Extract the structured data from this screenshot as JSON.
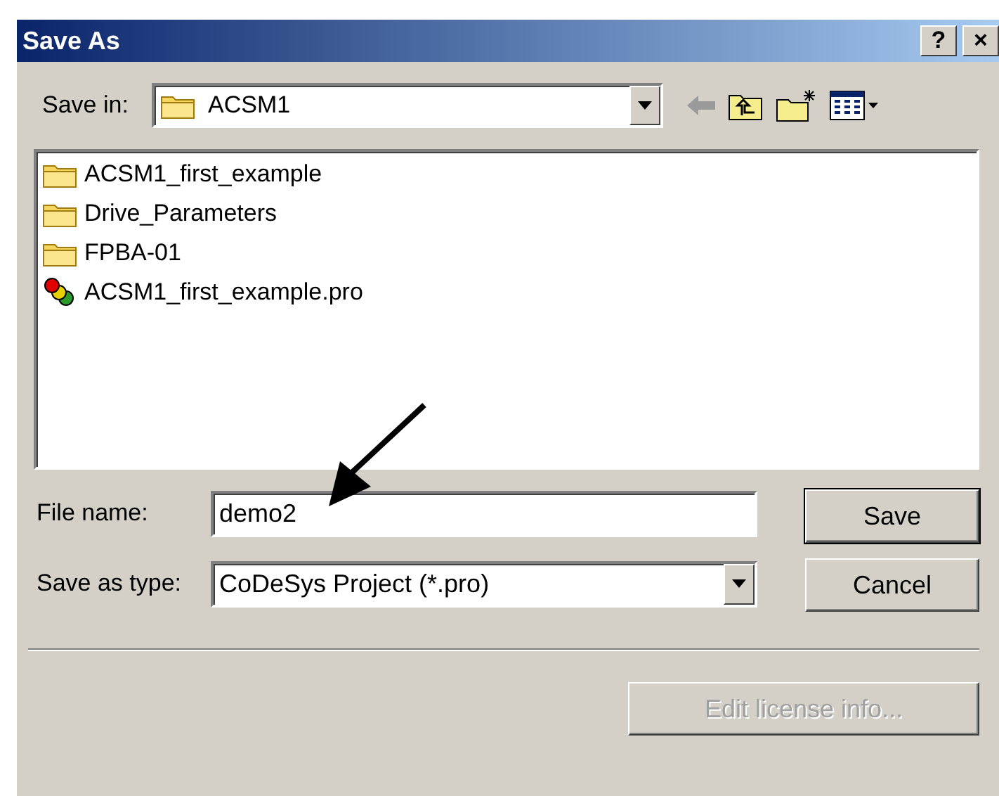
{
  "window": {
    "title": "Save As",
    "title_buttons": [
      "?",
      "×"
    ]
  },
  "save_in": {
    "label": "Save in:",
    "value": "ACSM1"
  },
  "files": [
    {
      "name": "ACSM1_first_example",
      "kind": "folder",
      "selected": false
    },
    {
      "name": "Drive_Parameters",
      "kind": "folder",
      "selected": false
    },
    {
      "name": "FPBA-01",
      "kind": "folder",
      "selected": false
    },
    {
      "name": "ACSM1_first_example.pro",
      "kind": "project",
      "selected": false
    }
  ],
  "file_name": {
    "label": "File name:",
    "value": "demo2"
  },
  "save_as_type": {
    "label": "Save as type:",
    "value": "CoDeSys Project (*.pro)"
  },
  "buttons": [
    {
      "label": "Save",
      "default": true,
      "disabled": false
    },
    {
      "label": "Cancel",
      "default": false,
      "disabled": false
    }
  ],
  "extra_button": {
    "label": "Edit license info...",
    "disabled": true
  }
}
